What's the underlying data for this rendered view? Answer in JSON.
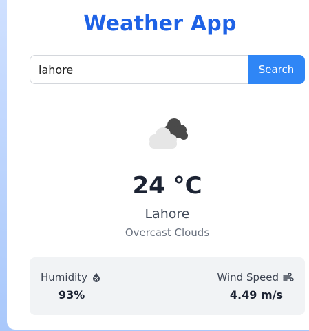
{
  "app": {
    "title": "Weather App"
  },
  "search": {
    "value": "lahore",
    "button_label": "Search"
  },
  "weather": {
    "icon": "cloud-icon",
    "temperature": "24 °C",
    "city": "Lahore",
    "description": "Overcast Clouds"
  },
  "stats": {
    "humidity": {
      "label": "Humidity",
      "icon": "droplet-percent-icon",
      "value": "93%"
    },
    "wind": {
      "label": "Wind Speed",
      "icon": "wind-icon",
      "value": "4.49 m/s"
    }
  },
  "colors": {
    "title": "#1e62e6",
    "button": "#2f86f6",
    "stats_bg": "#f1f3f5",
    "background_gradient_top": "#cfe0ff",
    "background_gradient_bottom": "#a9c8fb"
  }
}
